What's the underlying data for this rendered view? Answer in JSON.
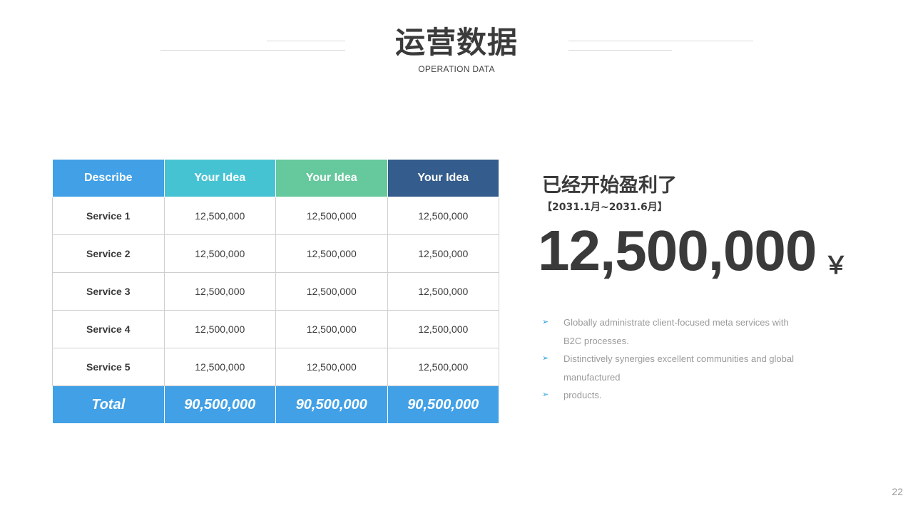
{
  "header": {
    "title": "运营数据",
    "subtitle": "OPERATION DATA"
  },
  "table": {
    "headers": [
      "Describe",
      "Your Idea",
      "Your Idea",
      "Your Idea"
    ],
    "header_colors": [
      "#41a0e6",
      "#46c3d3",
      "#66c89d",
      "#345c8c"
    ],
    "rows": [
      [
        "Service 1",
        "12,500,000",
        "12,500,000",
        "12,500,000"
      ],
      [
        "Service 2",
        "12,500,000",
        "12,500,000",
        "12,500,000"
      ],
      [
        "Service 3",
        "12,500,000",
        "12,500,000",
        "12,500,000"
      ],
      [
        "Service 4",
        "12,500,000",
        "12,500,000",
        "12,500,000"
      ],
      [
        "Service 5",
        "12,500,000",
        "12,500,000",
        "12,500,000"
      ]
    ],
    "total": [
      "Total",
      "90,500,000",
      "90,500,000",
      "90,500,000"
    ]
  },
  "summary": {
    "headline": "已经开始盈利了",
    "period": "【2031.1月~2031.6月】",
    "amount": "12,500,000",
    "currency": "￥"
  },
  "bullets": [
    "Globally administrate client-focused meta services with B2C processes.",
    "Distinctively synergies excellent communities and global manufactured",
    "products."
  ],
  "bullet_icon": "arrow-right-icon",
  "page_number": "22"
}
